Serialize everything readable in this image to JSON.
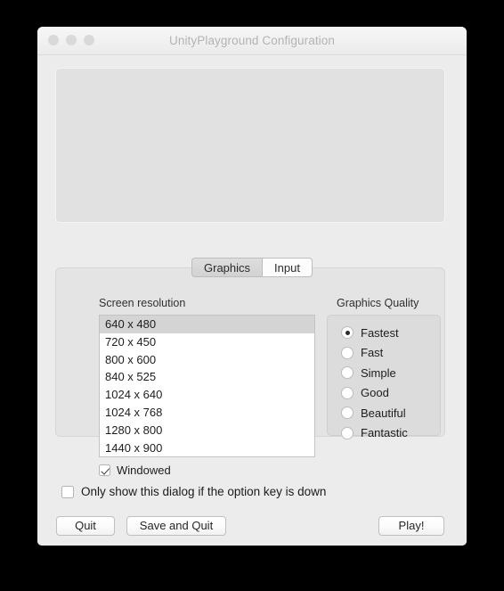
{
  "window": {
    "title": "UnityPlayground Configuration",
    "traffic_lights": [
      "close-button",
      "minimize-button",
      "zoom-button"
    ]
  },
  "banner": {
    "name": "splash-image-area",
    "content": ""
  },
  "tabs": [
    {
      "label": "Graphics",
      "active": false
    },
    {
      "label": "Input",
      "active": true
    }
  ],
  "graphics_tab": {
    "screen_resolution": {
      "label": "Screen resolution",
      "selected": "640 x 480",
      "options": [
        "640 x 480",
        "720 x 450",
        "800 x 600",
        "840 x 525",
        "1024 x 640",
        "1024 x 768",
        "1280 x 800",
        "1440 x 900"
      ]
    },
    "windowed": {
      "label": "Windowed",
      "checked": true
    },
    "graphics_quality": {
      "label": "Graphics Quality",
      "selected": "Fastest",
      "options": [
        "Fastest",
        "Fast",
        "Simple",
        "Good",
        "Beautiful",
        "Fantastic"
      ]
    }
  },
  "option_key": {
    "label": "Only show this dialog if the option key is down",
    "checked": false
  },
  "buttons": {
    "quit": "Quit",
    "save_and_quit": "Save and Quit",
    "play": "Play!"
  },
  "colors": {
    "window_bg": "#ececec",
    "panel_bg": "#e4e4e4",
    "group_bg": "#dcdcdc",
    "list_bg": "#ffffff",
    "selection": "#d4d4d4",
    "title_text": "#b3b3b3",
    "desktop": "#000000"
  }
}
